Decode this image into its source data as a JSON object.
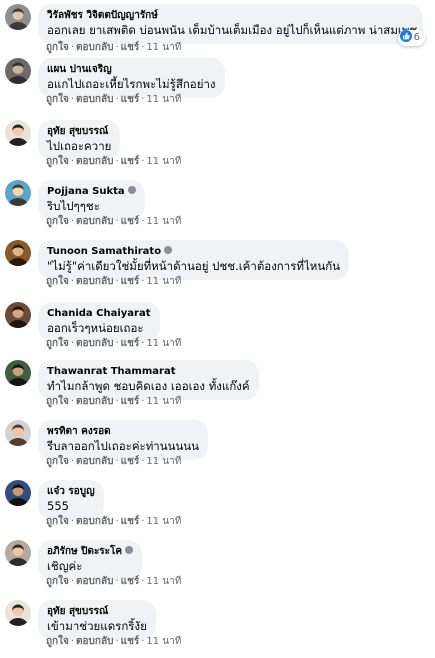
{
  "colors": {
    "bubble_background": "#f0f2f5",
    "author_text": "#050505",
    "meta_text": "#65676b",
    "like_blue": "#1877f2"
  },
  "actions": {
    "like": "ถูกใจ",
    "reply": "ตอบกลับ",
    "share": "แชร์",
    "separator": "·"
  },
  "comments": [
    {
      "author": "วิรัลพัชร วิจิตตปัญญารักษ์",
      "text": "ออกเลย ยาเสพติด บ่อนพนัน เต็มบ้านเต็มเมือง อยู่ไปก็เห็นแต่ภาพ น่าสมเพช",
      "time": "11 นาที",
      "reactions": {
        "icon": "like-icon",
        "count": "6"
      }
    },
    {
      "author": "แผน ปานเจริญ",
      "text": "อแกไปเถอะเหี้ยไรกพะไม่รู้สึกอย่าง",
      "time": "11 นาที"
    },
    {
      "author": "อุทัย สุขบรรณ์",
      "text": "ไปเถอะควาย",
      "time": "11 นาที"
    },
    {
      "author": "Pojjana Sukta",
      "text": "ริบไปๆๆชะ",
      "time": "11 นาที",
      "badge": "badge-icon"
    },
    {
      "author": "Tunoon Samathirato",
      "text": "\"ไม่รู้\"ค่าเดียวใช่มั้ยที่หน้าด้านอยู่ ปชช.เค้าต้องการที่ไหนกัน",
      "time": "11 นาที",
      "badge": "badge-icon"
    },
    {
      "author": "Chanida Chaiyarat",
      "text": "ออกเร็วๆหน่อยเถอะ",
      "time": "11 นาที"
    },
    {
      "author": "Thawanrat Thammarat",
      "text": "ทำไมกล้าพูด ชอบคิดเอง เออเอง ทั้งแก๊งค์",
      "time": "11 นาที"
    },
    {
      "author": "พรทิตา คงรอด",
      "text": "รีบลาออกไปเถอะค่ะท่านนนนน",
      "time": "11 นาที"
    },
    {
      "author": "แจ๋ว รอบูญ",
      "text": "555",
      "time": "11 นาที"
    },
    {
      "author": "อภิรักษ ปิดะระโค",
      "text": "เชิญค่ะ",
      "time": "11 นาที",
      "badge": "badge-icon"
    },
    {
      "author": "อุทัย สุขบรรณ์",
      "text": "เข้ามาช่วยแดรกริ้งัย",
      "time": "11 นาที"
    }
  ]
}
